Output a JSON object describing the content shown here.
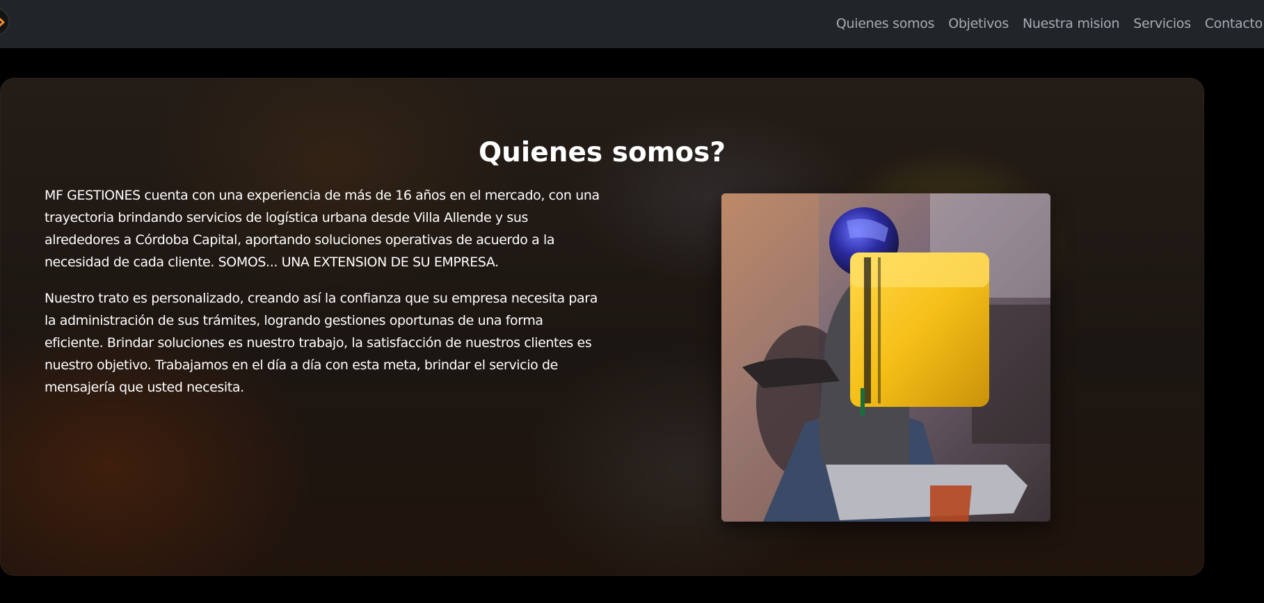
{
  "navbar": {
    "brand_icon": "arrow-logo-icon",
    "links": [
      "Quienes somos",
      "Objetivos",
      "Nuestra mision",
      "Servicios",
      "Contacto"
    ]
  },
  "hero": {
    "title": "Quienes somos?",
    "paragraphs": [
      "MF GESTIONES cuenta con una experiencia de más de 16 años en el mercado, con una trayectoria brindando servicios de logística urbana desde Villa Allende y sus alrededores a Córdoba Capital, aportando soluciones operativas de acuerdo a la necesidad de cada cliente. SOMOS... UNA EXTENSION DE SU EMPRESA.",
      "Nuestro trato es personalizado, creando así la confianza que su empresa necesita para la administración de sus trámites, logrando gestiones oportunas de una forma eficiente. Brindar soluciones es nuestro trabajo, la satisfacción de nuestros clientes es nuestro objetivo. Trabajamos en el día a día con esta meta, brindar el servicio de mensajería que usted necesita."
    ],
    "image_subject": "delivery-rider-yellow-backpack"
  },
  "colors": {
    "navbar_bg": "#212529",
    "nav_link": "#a8adb3",
    "page_bg": "#000000",
    "accent": "#f7c31c",
    "brand_orange": "#f28c28"
  }
}
